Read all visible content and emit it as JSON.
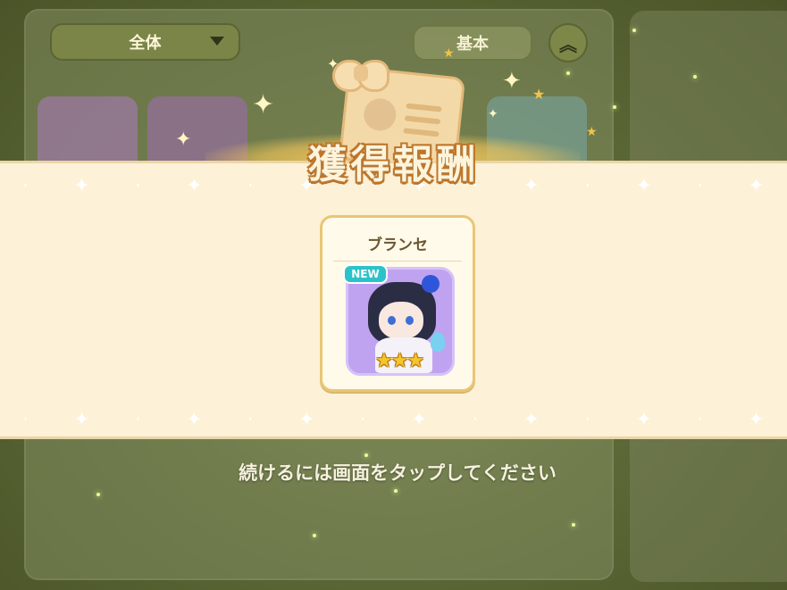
{
  "top_bar": {
    "filter_label": "全体",
    "basic_label": "基本"
  },
  "reward_screen": {
    "title": "獲得報酬",
    "reward_card": {
      "name": "ブランセ",
      "badge": "NEW",
      "rarity_stars": 3,
      "stars_text": "★★★"
    },
    "tap_hint": "続けるには画面をタップしてください"
  },
  "icons": {
    "filter_caret": "chevron-down-icon",
    "collapse": "double-chevron-up-icon",
    "sparkle": "sparkle-icon"
  },
  "colors": {
    "banner_bg": "#fdf1d7",
    "title_outline": "#c0772a",
    "new_badge": "#2cc2c9",
    "star": "#f6c52c",
    "portrait_bg": "#bfa3f0"
  }
}
